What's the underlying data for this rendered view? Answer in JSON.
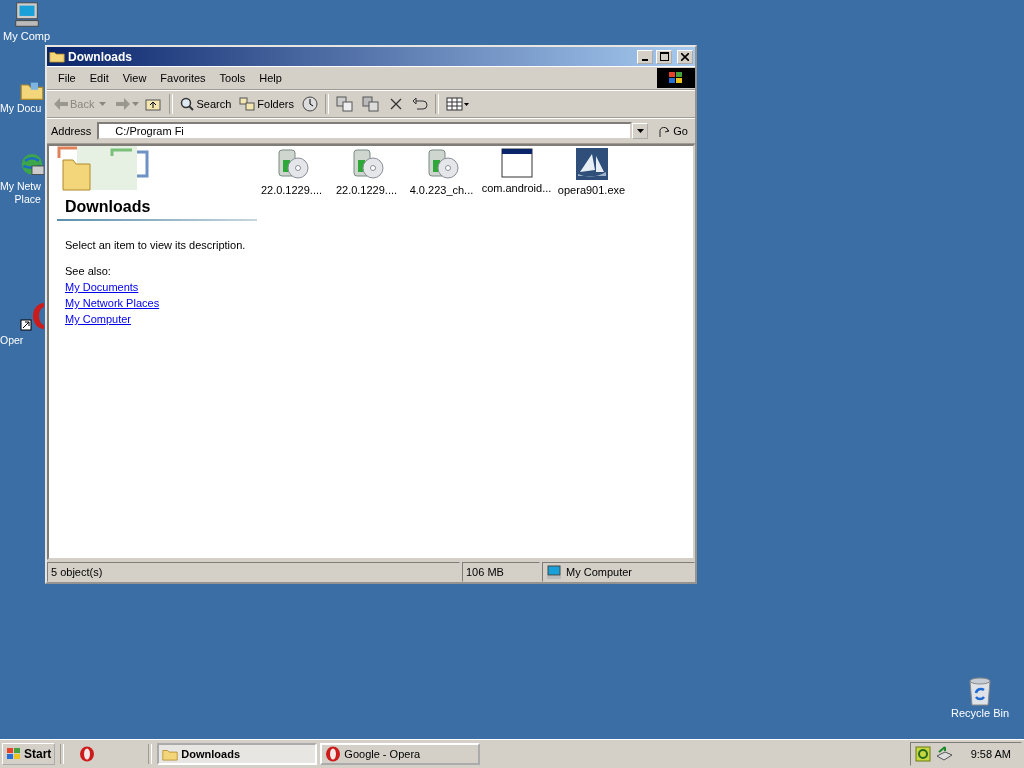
{
  "desktop_icons": [
    {
      "kind": "computer",
      "lines": [
        "My Comp"
      ]
    },
    {
      "kind": "documents",
      "lines": [
        "My Docu"
      ]
    },
    {
      "kind": "network",
      "lines": [
        "My Netw",
        "Place"
      ]
    },
    {
      "kind": "opera",
      "lines": [
        "Oper"
      ]
    },
    {
      "kind": "recycle",
      "lines": [
        "Recycle Bin"
      ]
    }
  ],
  "window": {
    "title": "Downloads",
    "menu": [
      "File",
      "Edit",
      "View",
      "Favorites",
      "Tools",
      "Help"
    ],
    "toolbar": {
      "back": {
        "label": "Back",
        "disabled": true
      },
      "search": {
        "label": "Search"
      },
      "folders": {
        "label": "Folders"
      }
    },
    "address": {
      "label": "Address",
      "value": "C:/Program Fi",
      "go": "Go"
    },
    "side_pane": {
      "title": "Downloads",
      "description": "Select an item to view its description.",
      "see_also": "See also:",
      "links": [
        "My Documents",
        "My Network Places",
        "My Computer"
      ]
    },
    "files": [
      {
        "name": "22.0.1229....",
        "kind": "installer"
      },
      {
        "name": "22.0.1229....",
        "kind": "installer"
      },
      {
        "name": "4.0.223_ch...",
        "kind": "installer"
      },
      {
        "name": "com.android...",
        "kind": "program"
      },
      {
        "name": "opera901.exe",
        "kind": "opera-setup"
      }
    ],
    "status_bar": {
      "objects": "5 object(s)",
      "size": "106 MB",
      "zone": "My Computer"
    }
  },
  "taskbar": {
    "start": "Start",
    "tasks": [
      {
        "label": "Downloads",
        "kind": "folder",
        "selected": true
      },
      {
        "label": "Google - Opera",
        "kind": "opera",
        "selected": false
      }
    ],
    "clock": "9:58 AM"
  }
}
